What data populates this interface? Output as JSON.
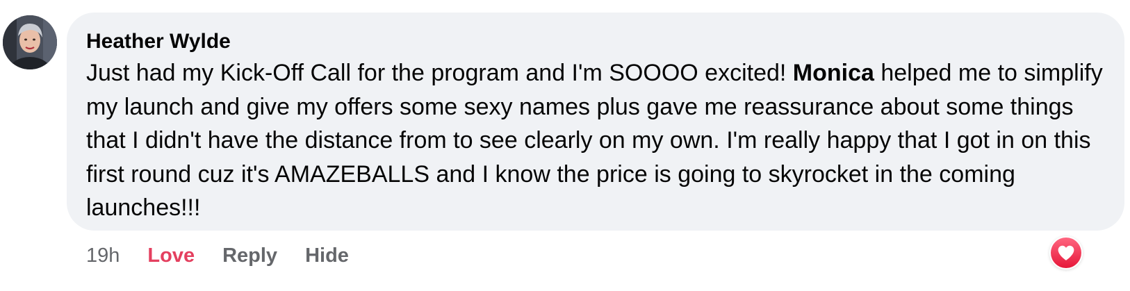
{
  "comment": {
    "author": "Heather Wylde",
    "text_part1": "Just had my Kick-Off Call for the program and I'm SOOOO excited! ",
    "mention": "Monica",
    "text_part2": " helped me to simplify my launch and give my offers some sexy names plus gave me reassurance about some things that I didn't have the distance from to see clearly on my own. I'm really happy that I got in on this first round cuz it's AMAZEBALLS and I know the price is going to skyrocket in the coming launches!!!"
  },
  "actions": {
    "timestamp": "19h",
    "love_label": "Love",
    "reply_label": "Reply",
    "hide_label": "Hide"
  },
  "reaction": {
    "icon": "heart-icon",
    "color": "#e4405f"
  },
  "colors": {
    "bubble_background": "#f0f2f5",
    "secondary_text": "#65676b",
    "love_active": "#e4405f"
  }
}
